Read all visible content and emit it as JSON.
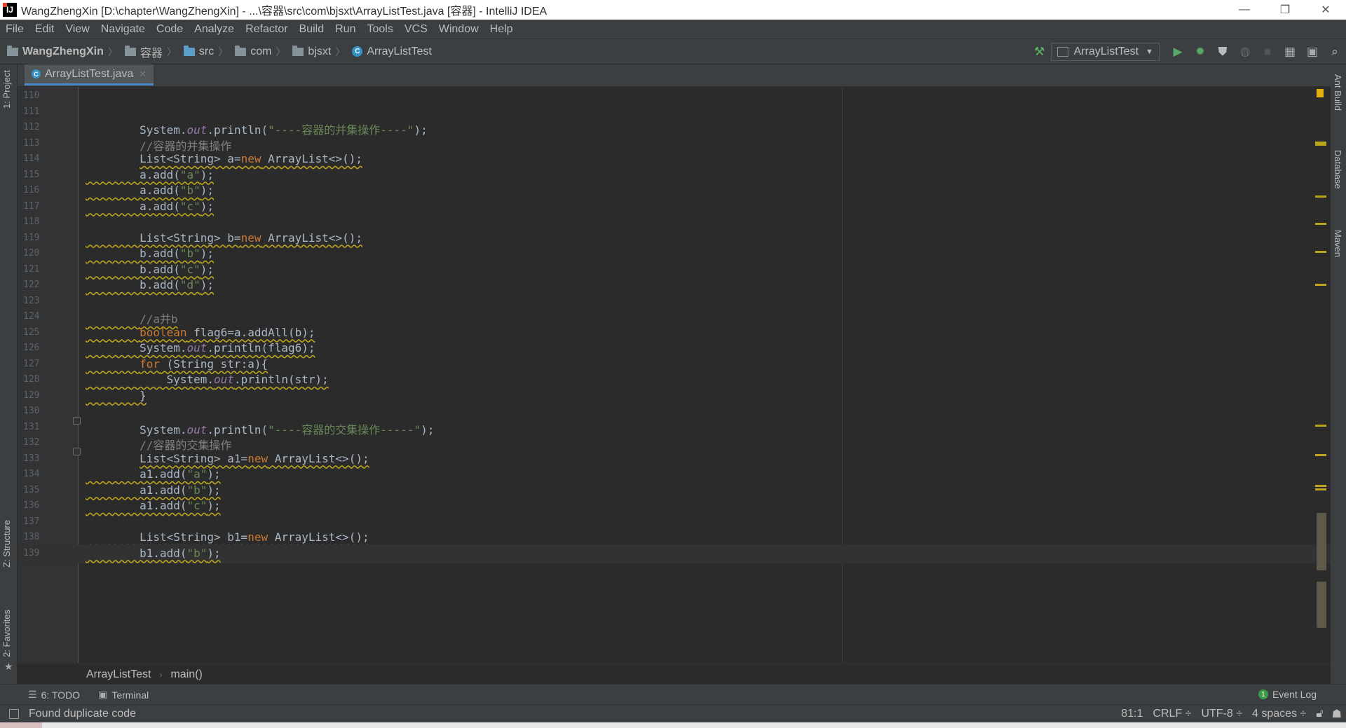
{
  "window": {
    "title": "WangZhengXin [D:\\chapter\\WangZhengXin] - ...\\容器\\src\\com\\bjsxt\\ArrayListTest.java [容器] - IntelliJ IDEA",
    "app_icon_text": "IJ",
    "minimize": "—",
    "maximize": "❐",
    "close": "✕"
  },
  "menu": [
    "File",
    "Edit",
    "View",
    "Navigate",
    "Code",
    "Analyze",
    "Refactor",
    "Build",
    "Run",
    "Tools",
    "VCS",
    "Window",
    "Help"
  ],
  "navbar": {
    "crumbs": [
      "WangZhengXin",
      "容器",
      "src",
      "com",
      "bjsxt",
      "ArrayListTest"
    ],
    "run_config": "ArrayListTest"
  },
  "tab": {
    "label": "ArrayListTest.java",
    "close": "✕",
    "icon_letter": "C"
  },
  "tool_windows": {
    "left_top": "1: Project",
    "left_structure": "Z: Structure",
    "left_favorites": "2: Favorites",
    "right_ant": "Ant Build",
    "right_database": "Database",
    "right_maven": "Maven"
  },
  "editor": {
    "current_line": 139,
    "lines": [
      {
        "n": "110",
        "tokens": []
      },
      {
        "n": "111",
        "tokens": []
      },
      {
        "n": "112",
        "tokens": [
          [
            "p",
            "        System."
          ],
          [
            "fld",
            "out"
          ],
          [
            "p",
            ".println("
          ],
          [
            "str",
            "\"----容器的并集操作----\""
          ],
          [
            "p",
            ");"
          ]
        ]
      },
      {
        "n": "113",
        "tokens": [
          [
            "cmt",
            "        //容器的并集操作"
          ]
        ]
      },
      {
        "n": "114",
        "tokens": [
          [
            "p",
            "        "
          ],
          [
            "pw",
            "List<String> a="
          ],
          [
            "kww",
            "new"
          ],
          [
            "pw",
            " ArrayList<>();"
          ]
        ]
      },
      {
        "n": "115",
        "tokens": [
          [
            "pw",
            "        a.add("
          ],
          [
            "strw",
            "\"a\""
          ],
          [
            "pw",
            ");"
          ]
        ]
      },
      {
        "n": "116",
        "tokens": [
          [
            "pw",
            "        a.add("
          ],
          [
            "strw",
            "\"b\""
          ],
          [
            "pw",
            ");"
          ]
        ]
      },
      {
        "n": "117",
        "tokens": [
          [
            "pw",
            "        a.add("
          ],
          [
            "strw",
            "\"c\""
          ],
          [
            "pw",
            ");"
          ]
        ]
      },
      {
        "n": "118",
        "tokens": []
      },
      {
        "n": "119",
        "tokens": [
          [
            "pw",
            "        List<String> b="
          ],
          [
            "kww",
            "new"
          ],
          [
            "pw",
            " ArrayList<>();"
          ]
        ]
      },
      {
        "n": "120",
        "tokens": [
          [
            "pw",
            "        b.add("
          ],
          [
            "strw",
            "\"b\""
          ],
          [
            "pw",
            ");"
          ]
        ]
      },
      {
        "n": "121",
        "tokens": [
          [
            "pw",
            "        b.add("
          ],
          [
            "strw",
            "\"c\""
          ],
          [
            "pw",
            ");"
          ]
        ]
      },
      {
        "n": "122",
        "tokens": [
          [
            "pw",
            "        b.add("
          ],
          [
            "strw",
            "\"d\""
          ],
          [
            "pw",
            ");"
          ]
        ]
      },
      {
        "n": "123",
        "tokens": []
      },
      {
        "n": "124",
        "tokens": [
          [
            "pw",
            "        "
          ],
          [
            "cmtw",
            "//a并b"
          ]
        ]
      },
      {
        "n": "125",
        "tokens": [
          [
            "pw",
            "        "
          ],
          [
            "kww",
            "boolean"
          ],
          [
            "pw",
            " flag6=a.addAll(b);"
          ]
        ]
      },
      {
        "n": "126",
        "tokens": [
          [
            "pw",
            "        System."
          ],
          [
            "fldw",
            "out"
          ],
          [
            "pw",
            ".println(flag6);"
          ]
        ]
      },
      {
        "n": "127",
        "tokens": [
          [
            "pw",
            "        "
          ],
          [
            "kww",
            "for"
          ],
          [
            "pw",
            " (String str:a){"
          ]
        ]
      },
      {
        "n": "128",
        "tokens": [
          [
            "pw",
            "            System."
          ],
          [
            "fldw",
            "out"
          ],
          [
            "pw",
            ".println(str);"
          ]
        ]
      },
      {
        "n": "129",
        "tokens": [
          [
            "pw",
            "        }"
          ]
        ]
      },
      {
        "n": "130",
        "tokens": []
      },
      {
        "n": "131",
        "tokens": [
          [
            "p",
            "        System."
          ],
          [
            "fld",
            "out"
          ],
          [
            "p",
            ".println("
          ],
          [
            "str",
            "\"----容器的交集操作-----\""
          ],
          [
            "p",
            ");"
          ]
        ]
      },
      {
        "n": "132",
        "tokens": [
          [
            "cmt",
            "        //容器的交集操作"
          ]
        ]
      },
      {
        "n": "133",
        "tokens": [
          [
            "p",
            "        "
          ],
          [
            "pw",
            "List<String> a1="
          ],
          [
            "kww",
            "new"
          ],
          [
            "pw",
            " ArrayList<>();"
          ]
        ]
      },
      {
        "n": "134",
        "tokens": [
          [
            "pw",
            "        a1.add("
          ],
          [
            "strw",
            "\"a\""
          ],
          [
            "pw",
            ");"
          ]
        ]
      },
      {
        "n": "135",
        "tokens": [
          [
            "pw",
            "        a1.add("
          ],
          [
            "strw",
            "\"b\""
          ],
          [
            "pw",
            ");"
          ]
        ]
      },
      {
        "n": "136",
        "tokens": [
          [
            "pw",
            "        a1.add("
          ],
          [
            "strw",
            "\"c\""
          ],
          [
            "pw",
            ");"
          ]
        ]
      },
      {
        "n": "137",
        "tokens": []
      },
      {
        "n": "138",
        "tokens": [
          [
            "pw",
            "        List<String> b1="
          ],
          [
            "kww",
            "new"
          ],
          [
            "pw",
            " ArrayList<>();"
          ]
        ]
      },
      {
        "n": "139",
        "tokens": [
          [
            "pw",
            "        b1.add("
          ],
          [
            "strw",
            "\"b\""
          ],
          [
            "pw",
            ");"
          ]
        ]
      }
    ]
  },
  "code_breadcrumbs": [
    "ArrayListTest",
    "main()"
  ],
  "bottom_tools": {
    "todo": "6: TODO",
    "terminal": "Terminal",
    "event_log": "Event Log",
    "event_count": "1"
  },
  "status": {
    "message": "Found duplicate code",
    "position": "81:1",
    "line_sep": "CRLF ÷",
    "encoding": "UTF-8 ÷",
    "indent": "4 spaces ÷"
  },
  "colors": {
    "editor_bg": "#2b2b2b",
    "chrome_bg": "#3c3f41",
    "keyword": "#cc7832",
    "string": "#6a8759",
    "field": "#9876aa",
    "comment": "#808080",
    "warning": "#bba41e"
  }
}
